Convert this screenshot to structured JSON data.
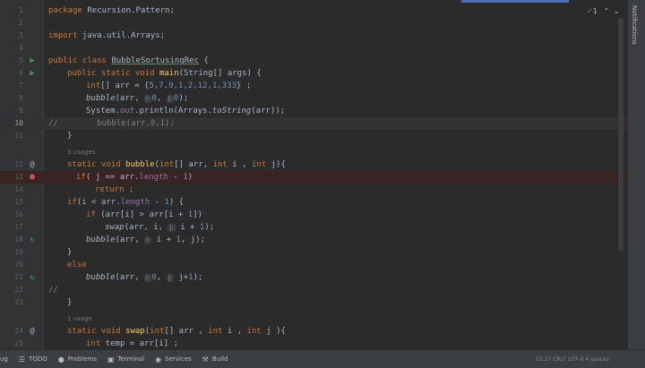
{
  "editor": {
    "lines": [
      {
        "n": "1"
      },
      {
        "n": "2"
      },
      {
        "n": "3"
      },
      {
        "n": "4"
      },
      {
        "n": "5"
      },
      {
        "n": "6"
      },
      {
        "n": "7"
      },
      {
        "n": "8"
      },
      {
        "n": "9"
      },
      {
        "n": "10"
      },
      {
        "n": "11"
      },
      {
        "n": "12"
      },
      {
        "n": "13"
      },
      {
        "n": "14"
      },
      {
        "n": "15"
      },
      {
        "n": "16"
      },
      {
        "n": "17"
      },
      {
        "n": "18"
      },
      {
        "n": "19"
      },
      {
        "n": "20"
      },
      {
        "n": "21"
      },
      {
        "n": "22"
      },
      {
        "n": "23"
      },
      {
        "n": "24"
      },
      {
        "n": "25"
      }
    ],
    "usages": {
      "bubble": "3 usages",
      "swap": "1 usage"
    },
    "code": {
      "l1_pkg": "package",
      "l1_name": " Recursion.Pattern;",
      "l3_imp": "import",
      "l3_name": " java.util.Arrays;",
      "l5_public": "public",
      "l5_class": " class ",
      "l5_name": "BubbleSortusingRec",
      "l5_rest": " {",
      "l6_mods": "public static void ",
      "l6_main": "main",
      "l6_rest": "(String[] args) {",
      "l7_type": "int",
      "l7_a": "[] arr = {",
      "l7_vals": "5,7,9,1,2,12,1,333",
      "l7_b": "} ;",
      "l8_call": "bubble",
      "l8_a": "(arr, ",
      "l8_hi": "i:",
      "l8_0": "0",
      ", ": ", ",
      "l8_hj": "j:",
      "l8_0b": "0",
      "l8_end": ");",
      "l9_a": "System.",
      "l9_out": "out",
      "l9_b": ".println(Arrays.",
      "l9_ts": "toString",
      "l9_c": "(arr));",
      "l10": "//        bubble(arr,0,1);",
      "l11": "}",
      "l12_mods": "static void ",
      "l12_fn": "bubble",
      "l12_a": "(",
      "l12_int1": "int",
      "l12_b": "[] arr, ",
      "l12_int2": "int",
      "l12_c": " i , ",
      "l12_int3": "int",
      "l12_d": " j){",
      "l13_if": "if",
      "l13_a": "( j == arr.",
      "l13_len": "length",
      "l13_b": " - ",
      "l13_1": "1",
      ")": ")",
      "l14_ret": "return",
      ";": " ;",
      "l15_if": "if",
      "l15_a": "(i < arr.",
      "l15_len": "length",
      "l15_b": " - ",
      "l15_1": "1",
      "l15_c": ") {",
      "l16_if": "if",
      "l16_a": " (arr[i] > arr[i + ",
      "l16_1": "1",
      "l16_b": "])",
      "l17_fn": "swap",
      "l17_a": "(arr, i, ",
      "l17_hj": "j:",
      "l17_b": " i + ",
      "l17_1": "1",
      "l17_c": ");",
      "l18_fn": "bubble",
      "l18_a": "(arr, ",
      "l18_hi": "i:",
      "l18_b": " i + ",
      "l18_1": "1",
      "l18_c": ", j);",
      "l19": "}",
      "l20": "else",
      "l21_fn": "bubble",
      "l21_a": "(arr, ",
      "l21_hi": "i:",
      "l21_0": "0",
      "l21_b": ", ",
      "l21_hj": "j:",
      "l21_c": " j+",
      "l21_1": "1",
      "l21_d": ");",
      "l22": "//",
      "l23": "}",
      "l24_mods": "static void ",
      "l24_fn": "swap",
      "l24_a": "(",
      "l24_int1": "int",
      "l24_b": "[] arr , ",
      "l24_int2": "int",
      "l24_c": " i , ",
      "l24_int3": "int",
      "l24_d": " j ){",
      "l25_int": "int",
      "l25_a": " temp = arr[i] ;"
    }
  },
  "top": {
    "check_count": "1"
  },
  "rightbar": {
    "label": "Notifications"
  },
  "statusbar": {
    "cut_left": "ug",
    "todo": "TODO",
    "problems": "Problems",
    "terminal": "Terminal",
    "services": "Services",
    "build": "Build",
    "right": "15:27   CRLF   UTF-8   4 spaces"
  },
  "colors": {
    "keyword": "#cc7832",
    "number": "#6897bb",
    "function": "#ffc66d",
    "breakpoint": "#c75450",
    "run": "#499c54"
  }
}
